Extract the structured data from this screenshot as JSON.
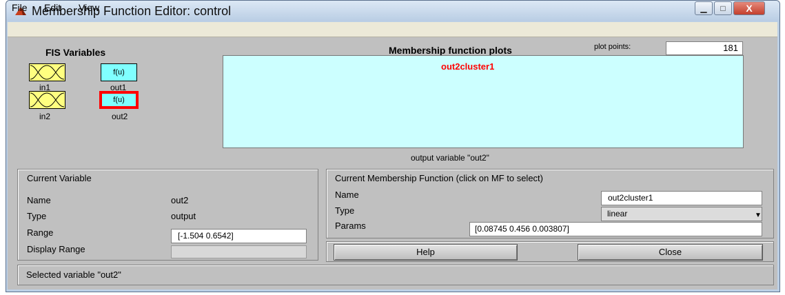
{
  "window": {
    "title": "Membership Function Editor: control",
    "controls": {
      "minimize": "▁",
      "maximize": "□",
      "close": "X"
    }
  },
  "menu": [
    "File",
    "Edit",
    "View"
  ],
  "fis_variables": {
    "title": "FIS Variables",
    "variables": [
      {
        "name": "in1",
        "kind": "input",
        "icon": "mf-curve-icon",
        "color": "#ffff80"
      },
      {
        "name": "out1",
        "kind": "output",
        "icon_text": "f(u)",
        "color": "#80ffff"
      },
      {
        "name": "in2",
        "kind": "input",
        "icon": "mf-curve-icon",
        "color": "#ffff80"
      },
      {
        "name": "out2",
        "kind": "output",
        "icon_text": "f(u)",
        "color": "#80ffff",
        "selected": true,
        "selection_color": "#ff0000"
      }
    ]
  },
  "plot": {
    "title": "Membership function plots",
    "plot_points_label": "plot points:",
    "plot_points_value": "181",
    "mf_name": "out2cluster1",
    "mf_name_color": "#ff0000",
    "background": "#ccffff",
    "xlabel": "output variable \"out2\""
  },
  "current_variable": {
    "heading": "Current Variable",
    "name_label": "Name",
    "name_value": "out2",
    "type_label": "Type",
    "type_value": "output",
    "range_label": "Range",
    "range_value": "[-1.504 0.6542]",
    "display_range_label": "Display Range",
    "display_range_value": ""
  },
  "current_mf": {
    "heading": "Current Membership Function (click on MF to select)",
    "name_label": "Name",
    "name_value": "out2cluster1",
    "type_label": "Type",
    "type_value": "linear",
    "params_label": "Params",
    "params_value": "[0.08745 0.456 0.003807]"
  },
  "buttons": {
    "help": "Help",
    "close": "Close"
  },
  "status": {
    "text": "Selected variable \"out2\""
  }
}
